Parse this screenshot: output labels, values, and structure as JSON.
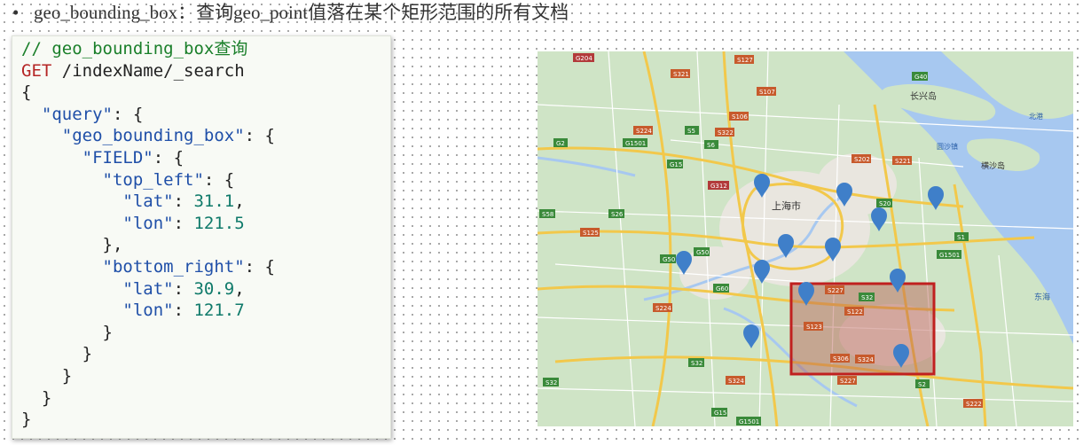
{
  "bullet": {
    "symbol": "•",
    "text": "geo_bounding_box：查询geo_point值落在某个矩形范围的所有文档"
  },
  "code": {
    "comment": "// geo_bounding_box查询",
    "method": "GET",
    "path": " /indexName/_search",
    "open_brace": "{",
    "query_key": "\"query\"",
    "geo_key": "\"geo_bounding_box\"",
    "field_key": "\"FIELD\"",
    "top_left_key": "\"top_left\"",
    "bottom_right_key": "\"bottom_right\"",
    "lat_key": "\"lat\"",
    "lon_key": "\"lon\"",
    "top_left_lat": "31.1",
    "top_left_lon": "121.5",
    "bottom_right_lat": "30.9",
    "bottom_right_lon": "121.7"
  },
  "map": {
    "colors": {
      "land": "#cfe4c6",
      "water": "#a7c8f0",
      "river": "#a7c8f0",
      "major_road": "#f2c84b",
      "minor_road": "#ffffff",
      "urban": "#e9e6df",
      "pin": "#3f7fc9",
      "box_border": "#c0201f",
      "box_fill": "#b85b50"
    },
    "labels": {
      "city": "上海市",
      "island": "长兴岛",
      "north_port": "北港",
      "yuansha": "圆沙镇",
      "hengsha": "横沙岛",
      "east_sea": "东海"
    },
    "roads": {
      "G204": "G204",
      "S127": "S127",
      "S321": "S321",
      "G40": "G40",
      "S107": "S107",
      "S106": "S106",
      "S224": "S224",
      "S5": "S5",
      "S322": "S322",
      "S6": "S6",
      "G2": "G2",
      "G1501a": "G1501",
      "G15": "G15",
      "S202": "S202",
      "S221": "S221",
      "G312": "G312",
      "S20": "S20",
      "S58": "S58",
      "S26": "S26",
      "S125": "S125",
      "S1": "S1",
      "G50": "G50",
      "G50b": "G50",
      "G1501b": "G1501",
      "G60": "G60",
      "S227": "S227",
      "S32": "S32",
      "S224b": "S224",
      "S122": "S122",
      "S123": "S123",
      "S306": "S306",
      "S324": "S324",
      "S32b": "S32",
      "S32c": "S32",
      "S324b": "S324",
      "S227b": "S227",
      "S2": "S2",
      "G15b": "G15",
      "G1501c": "G1501",
      "S222": "S222"
    }
  }
}
